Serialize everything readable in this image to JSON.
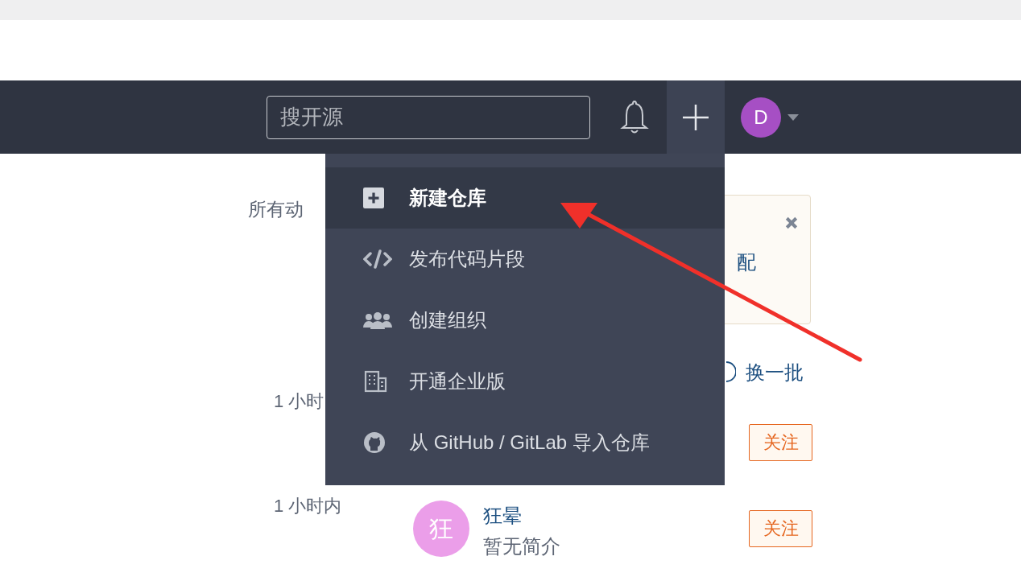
{
  "navbar": {
    "search": {
      "placeholder": "搜开源"
    },
    "avatar": {
      "initial": "D"
    }
  },
  "create_menu": {
    "items": [
      {
        "label": "新建仓库",
        "selected": true
      },
      {
        "label": "发布代码片段",
        "selected": false
      },
      {
        "label": "创建组织",
        "selected": false
      },
      {
        "label": "开通企业版",
        "selected": false
      },
      {
        "label": "从 GitHub / GitLab 导入仓库",
        "selected": false
      }
    ]
  },
  "feed": {
    "heading": "所有动",
    "notice": {
      "text": "配"
    },
    "refresh": "换一批",
    "rows": [
      {
        "time": "1 小时",
        "follow": "关注"
      },
      {
        "time": "1 小时内",
        "avatar": "狂",
        "name": "狂晕",
        "bio": "暂无简介",
        "follow": "关注"
      }
    ]
  }
}
